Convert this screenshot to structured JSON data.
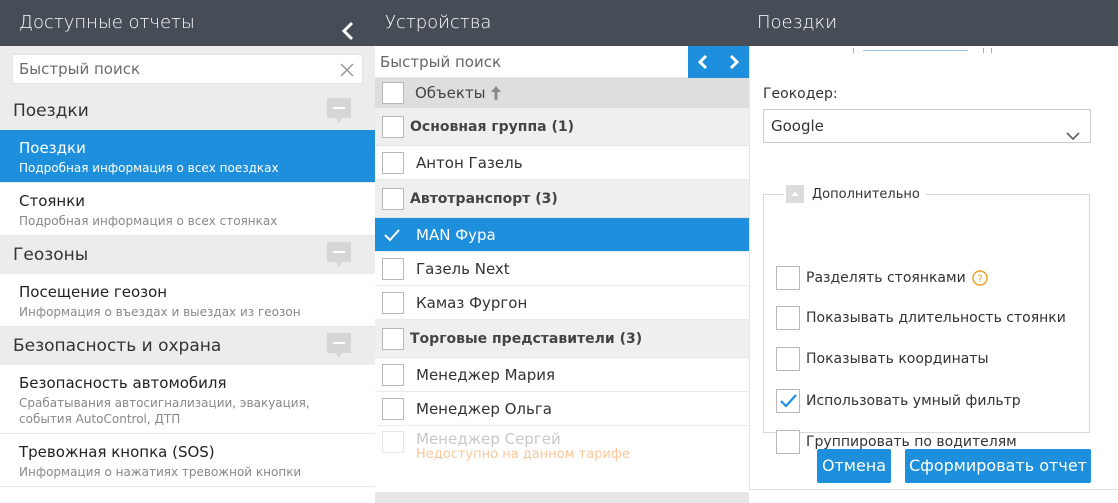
{
  "reports_panel": {
    "title": "Доступные отчеты",
    "search_placeholder": "Быстрый поиск",
    "groups": [
      {
        "name": "Поездки",
        "items": [
          {
            "title": "Поездки",
            "desc": "Подробная информация о всех поездках",
            "active": true
          },
          {
            "title": "Стоянки",
            "desc": "Подробная информация о всех стоянках",
            "active": false
          }
        ]
      },
      {
        "name": "Геозоны",
        "items": [
          {
            "title": "Посещение геозон",
            "desc": "Информация о въездах и выездах из геозон",
            "active": false
          }
        ]
      },
      {
        "name": "Безопасность и охрана",
        "items": [
          {
            "title": "Безопасность автомобиля",
            "desc": "Срабатывания автосигнализации, эвакуация, события AutoControl, ДТП",
            "active": false
          },
          {
            "title": "Тревожная кнопка (SOS)",
            "desc": "Информация о нажатиях тревожной кнопки",
            "active": false
          }
        ]
      }
    ]
  },
  "devices_panel": {
    "title": "Устройства",
    "search_placeholder": "Быстрый поиск",
    "column_header": "Объекты",
    "groups": [
      {
        "name": "Основная группа (1)",
        "items": [
          {
            "name": "Антон Газель",
            "selected": false
          }
        ]
      },
      {
        "name": "Автотранспорт (3)",
        "items": [
          {
            "name": "MAN Фура",
            "selected": true
          },
          {
            "name": "Газель Next",
            "selected": false
          },
          {
            "name": "Камаз Фургон",
            "selected": false
          }
        ]
      },
      {
        "name": "Торговые представители (3)",
        "items": [
          {
            "name": "Менеджер Мария",
            "selected": false
          },
          {
            "name": "Менеджер Ольга",
            "selected": false
          }
        ]
      }
    ],
    "disabled_item": {
      "name": "Менеджер Сергей",
      "note": "Недоступно на данном тарифе"
    }
  },
  "trips_panel": {
    "title": "Поездки",
    "geocoder_label": "Геокодер:",
    "geocoder_value": "Google",
    "advanced_legend": "Дополнительно",
    "options": [
      {
        "label": "Разделять стоянками",
        "checked": false,
        "help": true
      },
      {
        "label": "Показывать длительность стоянки",
        "checked": false,
        "help": false
      },
      {
        "label": "Показывать координаты",
        "checked": false,
        "help": false
      },
      {
        "label": "Использовать умный фильтр",
        "checked": true,
        "help": false
      },
      {
        "label": "Группировать по водителям",
        "checked": false,
        "help": false
      }
    ],
    "cancel_label": "Отмена",
    "submit_label": "Сформировать отчет"
  },
  "colors": {
    "accent": "#1e8fdc",
    "header": "#474d57"
  }
}
